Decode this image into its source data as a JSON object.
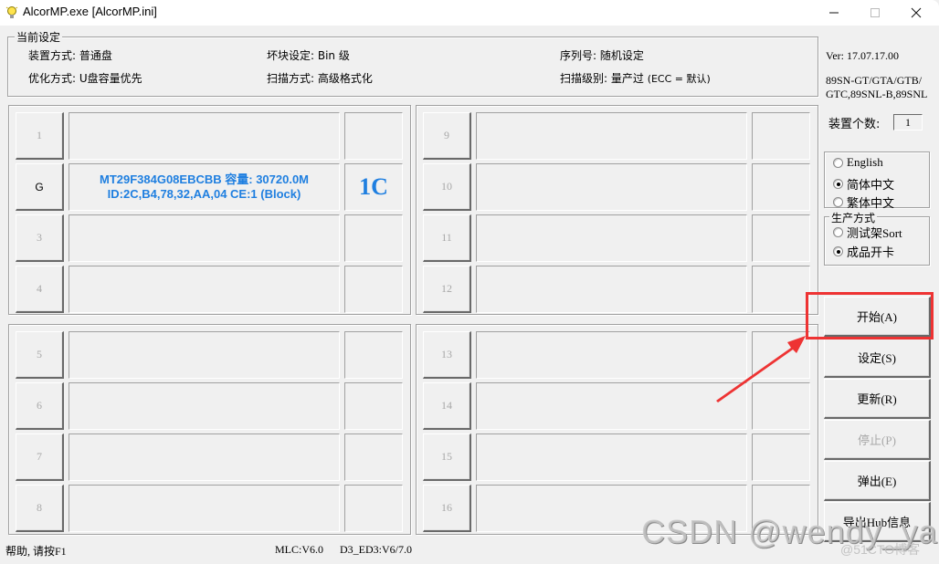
{
  "window": {
    "title": "AlcorMP.exe [AlcorMP.ini]",
    "controls": {
      "minimize": "—",
      "maximize": "☐",
      "close": "✕"
    }
  },
  "settings": {
    "group_label": "当前设定",
    "device_mode": "装置方式: 普通盘",
    "optimize_mode": "优化方式: U盘容量优先",
    "bad_block": "坏块设定: Bin 级",
    "scan_mode": "扫描方式: 高级格式化",
    "serial": "序列号: 随机设定",
    "scan_level_main": "扫描级别: 量产过 ",
    "scan_level_note": "(ECC = 默认)"
  },
  "slots": [
    {
      "label": "1",
      "info_line1": "",
      "info_line2": "",
      "status": "",
      "active": false
    },
    {
      "label": "G",
      "info_line1": "MT29F384G08EBCBB 容量: 30720.0M",
      "info_line2": "ID:2C,B4,78,32,AA,04 CE:1 (Block)",
      "status": "1C",
      "active": true
    },
    {
      "label": "3",
      "info_line1": "",
      "info_line2": "",
      "status": "",
      "active": false
    },
    {
      "label": "4",
      "info_line1": "",
      "info_line2": "",
      "status": "",
      "active": false
    },
    {
      "label": "5",
      "info_line1": "",
      "info_line2": "",
      "status": "",
      "active": false
    },
    {
      "label": "6",
      "info_line1": "",
      "info_line2": "",
      "status": "",
      "active": false
    },
    {
      "label": "7",
      "info_line1": "",
      "info_line2": "",
      "status": "",
      "active": false
    },
    {
      "label": "8",
      "info_line1": "",
      "info_line2": "",
      "status": "",
      "active": false
    },
    {
      "label": "9",
      "info_line1": "",
      "info_line2": "",
      "status": "",
      "active": false
    },
    {
      "label": "10",
      "info_line1": "",
      "info_line2": "",
      "status": "",
      "active": false
    },
    {
      "label": "11",
      "info_line1": "",
      "info_line2": "",
      "status": "",
      "active": false
    },
    {
      "label": "12",
      "info_line1": "",
      "info_line2": "",
      "status": "",
      "active": false
    },
    {
      "label": "13",
      "info_line1": "",
      "info_line2": "",
      "status": "",
      "active": false
    },
    {
      "label": "14",
      "info_line1": "",
      "info_line2": "",
      "status": "",
      "active": false
    },
    {
      "label": "15",
      "info_line1": "",
      "info_line2": "",
      "status": "",
      "active": false
    },
    {
      "label": "16",
      "info_line1": "",
      "info_line2": "",
      "status": "",
      "active": false
    }
  ],
  "side": {
    "version": "Ver: 17.07.17.00",
    "models_line1": "89SN-GT/GTA/GTB/",
    "models_line2": "GTC,89SNL-B,89SNL",
    "device_count_label": "装置个数:",
    "device_count": "1",
    "language": {
      "options": [
        {
          "label": "English",
          "checked": false
        },
        {
          "label": "简体中文",
          "checked": true
        },
        {
          "label": "繁体中文",
          "checked": false
        }
      ]
    },
    "production": {
      "group_label": "生产方式",
      "options": [
        {
          "label": "测试架Sort",
          "checked": false
        },
        {
          "label": "成品开卡",
          "checked": true
        }
      ]
    },
    "buttons": {
      "start": "开始(A)",
      "settings": "设定(S)",
      "refresh": "更新(R)",
      "stop": "停止(P)",
      "eject": "弹出(E)",
      "export_hub": "导出Hub信息"
    }
  },
  "statusbar": {
    "help": "帮助, 请按F1",
    "mlc": "MLC:V6.0",
    "d3": "D3_ED3:V6/7.0"
  },
  "annotation": {
    "highlight_color": "#ee3333",
    "watermark": "CSDN @wendy_ya",
    "watermark_small": "@51CTO博客"
  }
}
